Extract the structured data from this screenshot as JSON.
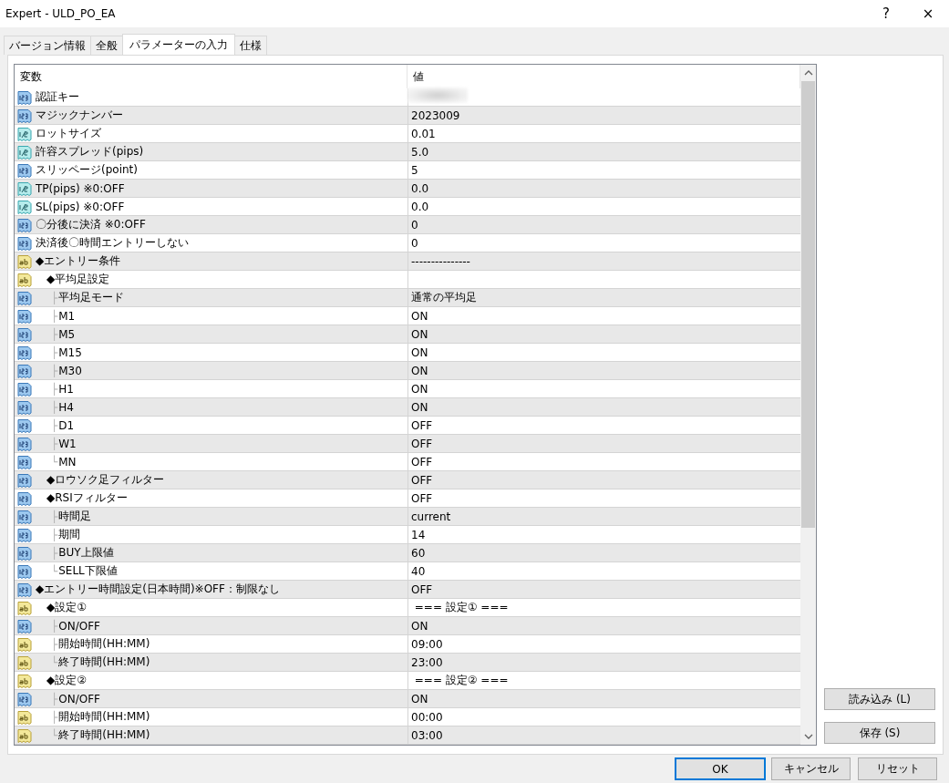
{
  "window": {
    "title": "Expert - ULD_PO_EA",
    "help": "?",
    "close": "×"
  },
  "tabs": [
    {
      "label": "バージョン情報",
      "selected": false
    },
    {
      "label": "全般",
      "selected": false
    },
    {
      "label": "パラメーターの入力",
      "selected": true
    },
    {
      "label": "仕様",
      "selected": false
    }
  ],
  "table": {
    "columns": [
      "変数",
      "値"
    ],
    "rows": [
      {
        "kind": "int",
        "name": "認証キー",
        "redacted": true
      },
      {
        "kind": "int",
        "name": "マジックナンバー",
        "value": "2023009"
      },
      {
        "kind": "double",
        "name": "ロットサイズ",
        "value": "0.01"
      },
      {
        "kind": "double",
        "name": "許容スプレッド(pips)",
        "value": "5.0"
      },
      {
        "kind": "int",
        "name": "スリッページ(point)",
        "value": "5"
      },
      {
        "kind": "double",
        "name": "TP(pips) ※0:OFF",
        "value": "0.0"
      },
      {
        "kind": "double",
        "name": "SL(pips) ※0:OFF",
        "value": "0.0"
      },
      {
        "kind": "int",
        "name": "〇分後に決済 ※0:OFF",
        "value": "0"
      },
      {
        "kind": "int",
        "name": "決済後〇時間エントリーしない",
        "value": "0"
      },
      {
        "kind": "string",
        "name": "◆エントリー条件",
        "value": "---------------",
        "children": [
          {
            "kind": "string",
            "name": "◆平均足設定",
            "children": [
              {
                "kind": "int",
                "branch": "├",
                "name": "平均足モード",
                "value": "通常の平均足"
              },
              {
                "kind": "int",
                "branch": "├",
                "name": "M1",
                "value": "ON"
              },
              {
                "kind": "int",
                "branch": "├",
                "name": "M5",
                "value": "ON"
              },
              {
                "kind": "int",
                "branch": "├",
                "name": "M15",
                "value": "ON"
              },
              {
                "kind": "int",
                "branch": "├",
                "name": "M30",
                "value": "ON"
              },
              {
                "kind": "int",
                "branch": "├",
                "name": "H1",
                "value": "ON"
              },
              {
                "kind": "int",
                "branch": "├",
                "name": "H4",
                "value": "ON"
              },
              {
                "kind": "int",
                "branch": "├",
                "name": "D1",
                "value": "OFF"
              },
              {
                "kind": "int",
                "branch": "├",
                "name": "W1",
                "value": "OFF"
              },
              {
                "kind": "int",
                "branch": "└",
                "name": "MN",
                "value": "OFF"
              }
            ]
          },
          {
            "kind": "int",
            "name": "◆ロウソク足フィルター",
            "value": "OFF"
          },
          {
            "kind": "int",
            "name": "◆RSIフィルター",
            "value": "OFF",
            "children": [
              {
                "kind": "int",
                "branch": "├",
                "name": "時間足",
                "value": "current"
              },
              {
                "kind": "int",
                "branch": "├",
                "name": "期間",
                "value": "14"
              },
              {
                "kind": "int",
                "branch": "├",
                "name": "BUY上限値",
                "value": "60"
              },
              {
                "kind": "int",
                "branch": "└",
                "name": "SELL下限値",
                "value": "40"
              }
            ]
          }
        ]
      },
      {
        "kind": "int",
        "name": "◆エントリー時間設定(日本時間)※OFF：制限なし",
        "value": "OFF",
        "children": [
          {
            "kind": "string",
            "name": "◆設定①",
            "value": " === 設定① ===",
            "children": [
              {
                "kind": "int",
                "branch": "├",
                "name": "ON/OFF",
                "value": "ON"
              },
              {
                "kind": "string",
                "branch": "├",
                "name": "開始時間(HH:MM)",
                "value": "09:00"
              },
              {
                "kind": "string",
                "branch": "└",
                "name": "終了時間(HH:MM)",
                "value": "23:00"
              }
            ]
          },
          {
            "kind": "string",
            "name": "◆設定②",
            "value": " === 設定② ===",
            "children": [
              {
                "kind": "int",
                "branch": "├",
                "name": "ON/OFF",
                "value": "ON"
              },
              {
                "kind": "string",
                "branch": "├",
                "name": "開始時間(HH:MM)",
                "value": "00:00"
              },
              {
                "kind": "string",
                "branch": "└",
                "name": "終了時間(HH:MM)",
                "value": "03:00"
              }
            ]
          }
        ]
      }
    ]
  },
  "side_buttons": [
    "読み込み (L)",
    "保存 (S)"
  ],
  "buttons": [
    {
      "label": "OK",
      "default": true
    },
    {
      "label": "キャンセル",
      "default": false
    },
    {
      "label": "リセット",
      "default": false
    }
  ]
}
